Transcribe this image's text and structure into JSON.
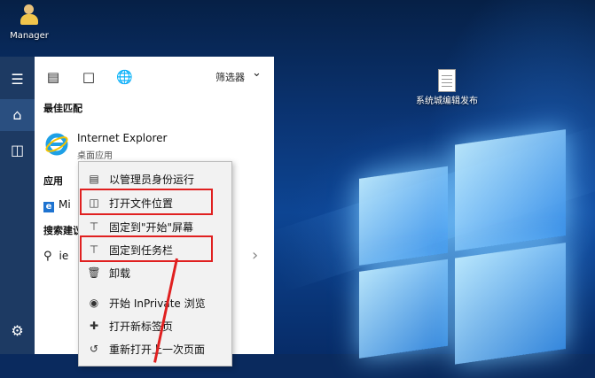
{
  "desktop": {
    "icons": [
      {
        "label": "Manager",
        "icon": "user-folder-icon"
      },
      {
        "label": "系统城编辑发布",
        "icon": "document-icon"
      }
    ]
  },
  "start_rail": {
    "items": [
      {
        "icon": "hamburger-menu-icon"
      },
      {
        "icon": "home-icon"
      },
      {
        "icon": "document-library-icon"
      },
      {
        "icon": "settings-gear-icon"
      }
    ]
  },
  "start_panel": {
    "filter_icons": [
      "apps-view-icon",
      "documents-filter-icon",
      "web-filter-icon"
    ],
    "filter_label": "筛选器",
    "best_match_heading": "最佳匹配",
    "best_match": {
      "title": "Internet Explorer",
      "subtitle": "桌面应用"
    },
    "apps_heading": "应用",
    "app_item_partial": "Mi",
    "search_suggestions_heading": "搜索建议",
    "search_query_partial": "ie"
  },
  "context_menu": {
    "items": [
      {
        "label": "以管理员身份运行",
        "icon": "run-as-admin-icon"
      },
      {
        "label": "打开文件位置",
        "icon": "open-file-location-icon"
      },
      {
        "label": "固定到\"开始\"屏幕",
        "icon": "pin-icon"
      },
      {
        "label": "固定到任务栏",
        "icon": "pin-taskbar-icon"
      },
      {
        "label": "卸载",
        "icon": "trash-icon"
      },
      {
        "label": "开始 InPrivate 浏览",
        "icon": "inprivate-icon"
      },
      {
        "label": "打开新标签页",
        "icon": "new-tab-icon"
      },
      {
        "label": "重新打开上一次页面",
        "icon": "reopen-page-icon"
      }
    ]
  },
  "colors": {
    "highlight": "#e02020",
    "accent_rail": "#1d3a63"
  }
}
